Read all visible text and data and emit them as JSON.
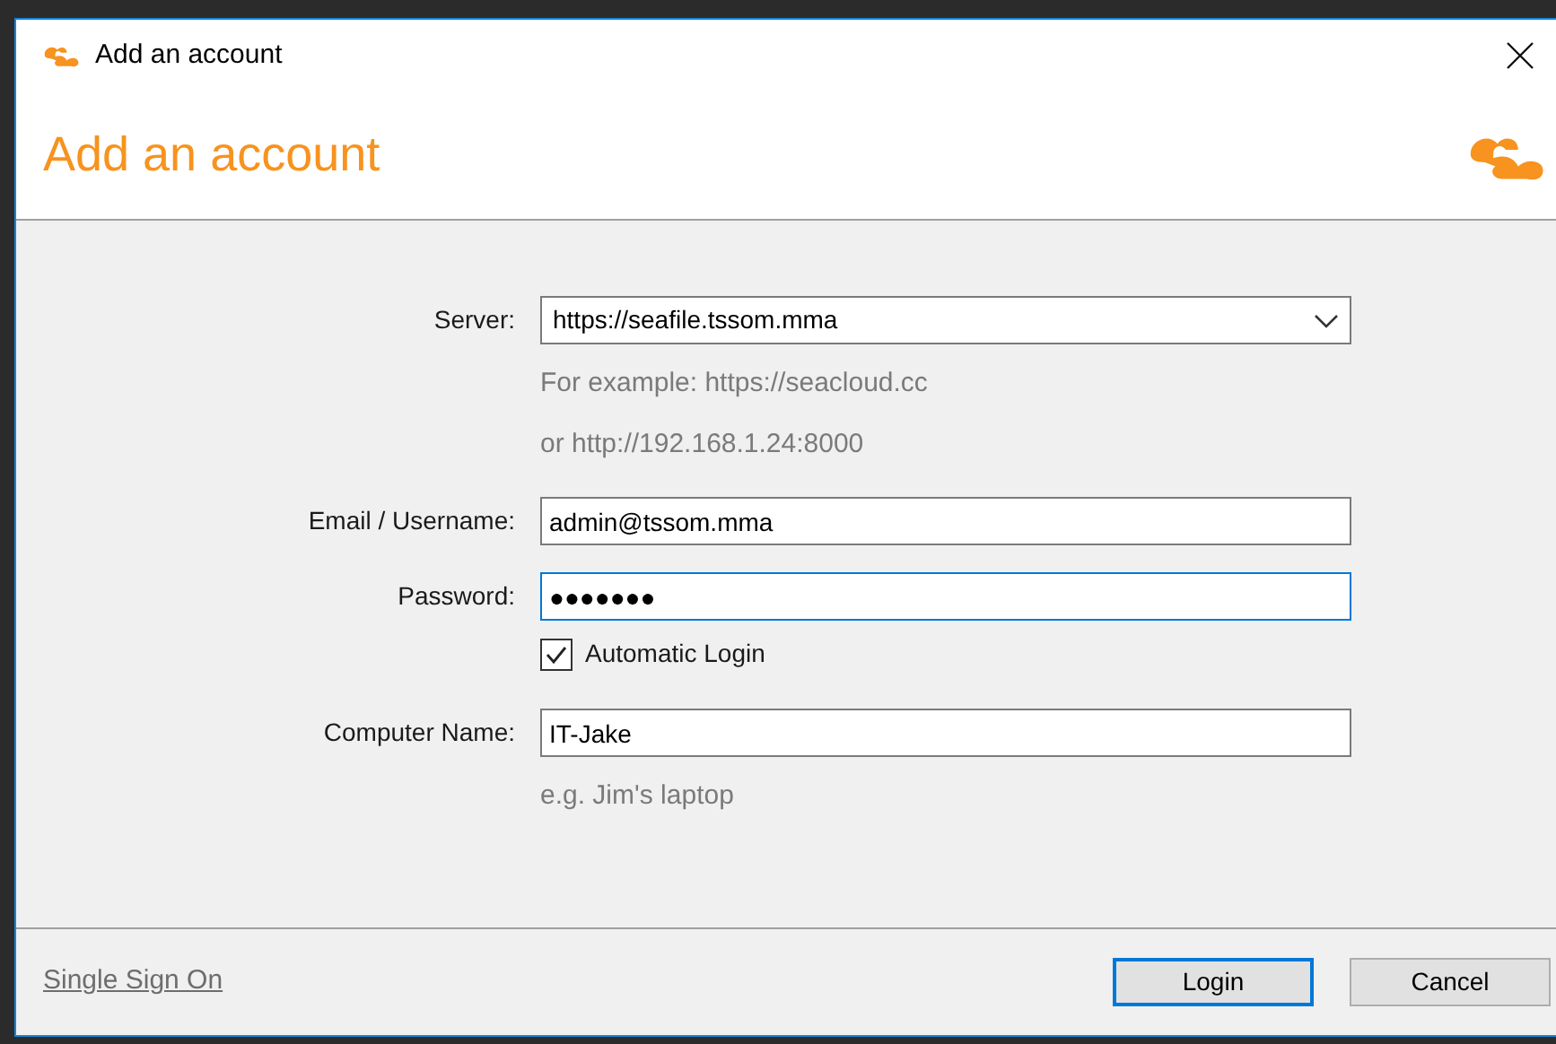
{
  "window": {
    "title": "Add an account"
  },
  "header": {
    "title": "Add an account"
  },
  "fields": [
    {
      "kind": "dropdown",
      "label": "Server:",
      "value": "https://seafile.tssom.mma",
      "focused": false,
      "hints": [
        "For example: https://seacloud.cc",
        "or http://192.168.1.24:8000"
      ]
    },
    {
      "kind": "text",
      "label": "Email / Username:",
      "value": "admin@tssom.mma",
      "focused": false
    },
    {
      "kind": "text",
      "label": "Password:",
      "value": "●●●●●●●",
      "focused": true
    },
    {
      "kind": "checkbox",
      "label": "Automatic Login",
      "checked": true
    },
    {
      "kind": "text",
      "label": "Computer Name:",
      "value": "IT-Jake",
      "focused": false,
      "hints": [
        "e.g. Jim's laptop"
      ]
    }
  ],
  "footer": {
    "link": "Single Sign On",
    "buttons": [
      {
        "label": "Login",
        "default": true
      },
      {
        "label": "Cancel",
        "default": false
      }
    ]
  }
}
